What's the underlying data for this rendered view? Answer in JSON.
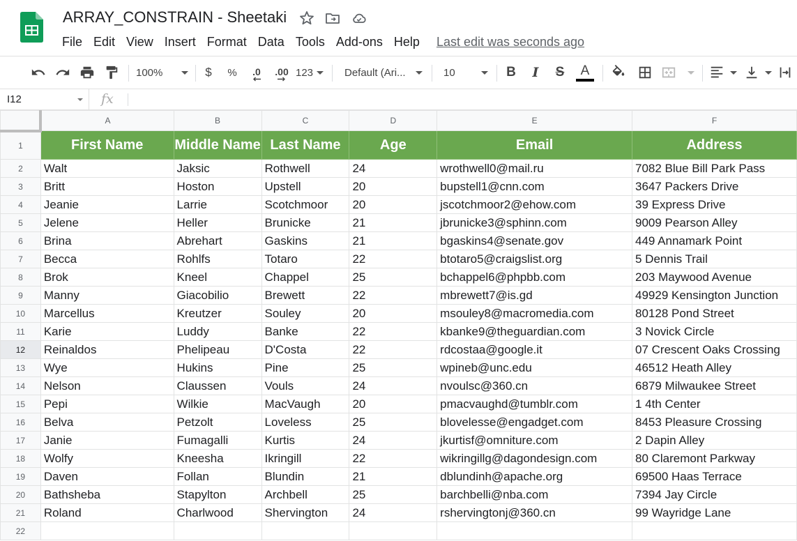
{
  "app": {
    "doc_title": "ARRAY_CONSTRAIN - Sheetaki",
    "menus": [
      "File",
      "Edit",
      "View",
      "Insert",
      "Format",
      "Data",
      "Tools",
      "Add-ons",
      "Help"
    ],
    "last_edit": "Last edit was seconds ago"
  },
  "toolbar": {
    "zoom": "100%",
    "currency": "$",
    "percent": "%",
    "dec_decrease": ".0",
    "dec_increase": ".00",
    "more_formats": "123",
    "font": "Default (Ari...",
    "font_size": "10",
    "bold": "B",
    "italic": "I",
    "strike": "S",
    "text_color_glyph": "A"
  },
  "formula_bar": {
    "cell_ref": "I12",
    "fx": "fx",
    "value": ""
  },
  "colors": {
    "header_fill": "#6aa84f",
    "header_text": "#ffffff",
    "logo": "#0f9d58"
  },
  "sheet": {
    "columns": [
      "A",
      "B",
      "C",
      "D",
      "E",
      "F"
    ],
    "headers": [
      "First Name",
      "Middle Name",
      "Last Name",
      "Age",
      "Email",
      "Address"
    ],
    "row_numbers": [
      "1",
      "2",
      "3",
      "4",
      "5",
      "6",
      "7",
      "8",
      "9",
      "10",
      "11",
      "12",
      "13",
      "14",
      "15",
      "16",
      "17",
      "18",
      "19",
      "20",
      "21",
      "22"
    ],
    "selected_row": "12",
    "rows": [
      [
        "Walt",
        "Jaksic",
        "Rothwell",
        "24",
        "wrothwell0@mail.ru",
        "7082 Blue Bill Park Pass"
      ],
      [
        "Britt",
        "Hoston",
        "Upstell",
        "20",
        "bupstell1@cnn.com",
        "3647 Packers Drive"
      ],
      [
        "Jeanie",
        "Larrie",
        "Scotchmoor",
        "20",
        "jscotchmoor2@ehow.com",
        "39 Express Drive"
      ],
      [
        "Jelene",
        "Heller",
        "Brunicke",
        "21",
        "jbrunicke3@sphinn.com",
        "9009 Pearson Alley"
      ],
      [
        "Brina",
        "Abrehart",
        "Gaskins",
        "21",
        "bgaskins4@senate.gov",
        "449 Annamark Point"
      ],
      [
        "Becca",
        "Rohlfs",
        "Totaro",
        "22",
        "btotaro5@craigslist.org",
        "5 Dennis Trail"
      ],
      [
        "Brok",
        "Kneel",
        "Chappel",
        "25",
        "bchappel6@phpbb.com",
        "203 Maywood Avenue"
      ],
      [
        "Manny",
        "Giacobilio",
        "Brewett",
        "22",
        "mbrewett7@is.gd",
        "49929 Kensington Junction"
      ],
      [
        "Marcellus",
        "Kreutzer",
        "Souley",
        "20",
        "msouley8@macromedia.com",
        "80128 Pond Street"
      ],
      [
        "Karie",
        "Luddy",
        "Banke",
        "22",
        "kbanke9@theguardian.com",
        "3 Novick Circle"
      ],
      [
        "Reinaldos",
        "Phelipeau",
        "D'Costa",
        "22",
        "rdcostaa@google.it",
        "07 Crescent Oaks Crossing"
      ],
      [
        "Wye",
        "Hukins",
        "Pine",
        "25",
        "wpineb@unc.edu",
        "46512 Heath Alley"
      ],
      [
        "Nelson",
        "Claussen",
        "Vouls",
        "24",
        "nvoulsc@360.cn",
        "6879 Milwaukee Street"
      ],
      [
        "Pepi",
        "Wilkie",
        "MacVaugh",
        "20",
        "pmacvaughd@tumblr.com",
        "1 4th Center"
      ],
      [
        "Belva",
        "Petzolt",
        "Loveless",
        "25",
        "blovelesse@engadget.com",
        "8453 Pleasure Crossing"
      ],
      [
        "Janie",
        "Fumagalli",
        "Kurtis",
        "24",
        "jkurtisf@omniture.com",
        "2 Dapin Alley"
      ],
      [
        "Wolfy",
        "Kneesha",
        "Ikringill",
        "22",
        "wikringillg@dagondesign.com",
        "80 Claremont Parkway"
      ],
      [
        "Daven",
        "Follan",
        "Blundin",
        "21",
        "dblundinh@apache.org",
        "69500 Haas Terrace"
      ],
      [
        "Bathsheba",
        "Stapylton",
        "Archbell",
        "25",
        "barchbelli@nba.com",
        "7394 Jay Circle"
      ],
      [
        "Roland",
        "Charlwood",
        "Shervington",
        "24",
        "rshervingtonj@360.cn",
        "99 Wayridge Lane"
      ],
      [
        "",
        "",
        "",
        "",
        "",
        ""
      ]
    ]
  }
}
